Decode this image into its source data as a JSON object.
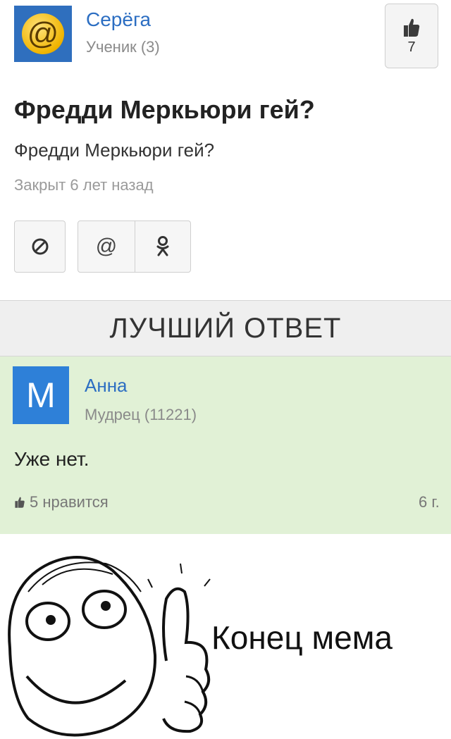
{
  "question": {
    "author_name": "Серёга",
    "author_rank": "Ученик (3)",
    "like_count": "7",
    "title": "Фредди Меркьюри гей?",
    "text": "Фредди Меркьюри гей?",
    "status": "Закрыт 6 лет назад",
    "avatar_icon": "at-sign-icon",
    "share_buttons": [
      {
        "name": "block-icon",
        "glyph": "⊘"
      },
      {
        "name": "mail-at-icon",
        "glyph": "@"
      },
      {
        "name": "odnoklassniki-icon",
        "glyph": "ok"
      }
    ]
  },
  "best_answer": {
    "heading": "ЛУЧШИЙ ОТВЕТ",
    "avatar_letter": "М",
    "author_name": "Анна",
    "author_rank": "Мудрец (11221)",
    "text": "Уже нет.",
    "likes": "5 нравится",
    "age": "6 г.",
    "background_color": "#e1f1d6"
  },
  "meme": {
    "caption": "Конец мема"
  },
  "colors": {
    "link_blue": "#2c6ec2",
    "avatar_blue": "#2e80d8",
    "answer_green": "#e1f1d6"
  }
}
